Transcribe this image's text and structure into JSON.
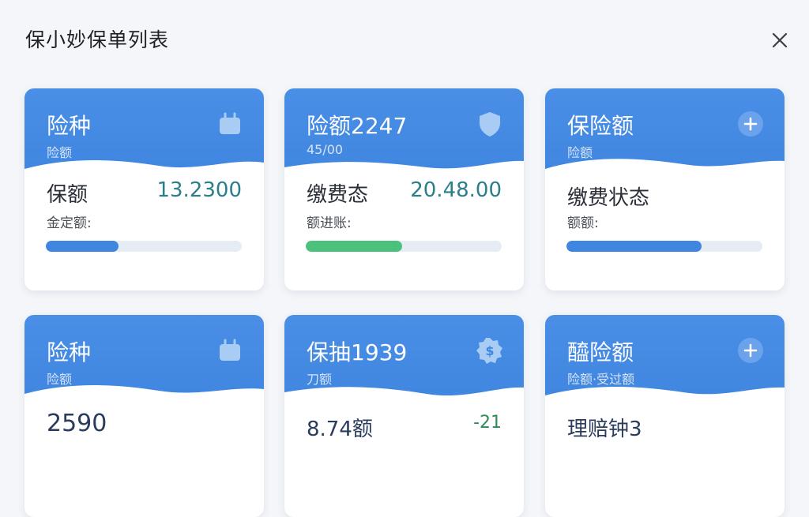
{
  "header": {
    "title": "保小妙保单列表",
    "close_icon": "close-icon"
  },
  "colors": {
    "card_header": "#4a8ee6",
    "bar_blue": "#3f86e0",
    "bar_green": "#4cc17b",
    "amount": "#2b7f8a"
  },
  "cards": [
    {
      "title": "险种",
      "subtitle": "险额",
      "icon": "briefcase-icon",
      "label": "保额",
      "amount": "13.2300",
      "sub": "金定额:",
      "progress": 0.37,
      "bar_color": "#3f86e0"
    },
    {
      "title": "险额2247",
      "subtitle": "45/00",
      "icon": "shield-icon",
      "label": "缴费态",
      "amount": "20.48.00",
      "sub": "额进账:",
      "progress": 0.49,
      "bar_color": "#4cc17b"
    },
    {
      "title": "保险额",
      "subtitle": "险额",
      "icon": "plus-icon",
      "label": "缴费状态",
      "amount": "",
      "sub": "额额:",
      "progress": 0.69,
      "bar_color": "#3f86e0"
    },
    {
      "title": "险种",
      "subtitle": "险额",
      "icon": "briefcase-icon",
      "label": "",
      "amount": "",
      "big": "2590",
      "sub": ""
    },
    {
      "title": "保抽1939",
      "subtitle": "刀额",
      "icon": "dollar-badge-icon",
      "label": "8.74额",
      "amount": "-21",
      "sub": ""
    },
    {
      "title": "醯险额",
      "subtitle": "险额·受过额",
      "icon": "plus-icon",
      "label": "理赔钟3",
      "amount": "",
      "sub": ""
    }
  ]
}
